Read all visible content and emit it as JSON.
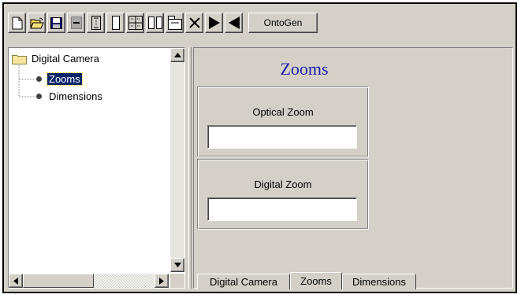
{
  "toolbar": {
    "buttons": [
      {
        "name": "new-document-icon"
      },
      {
        "name": "open-folder-icon"
      },
      {
        "name": "save-disk-icon"
      },
      {
        "name": "horizontal-field-icon"
      },
      {
        "name": "vertical-field-icon"
      },
      {
        "name": "single-panel-icon"
      },
      {
        "name": "grid-layout-icon"
      },
      {
        "name": "two-column-icon"
      },
      {
        "name": "tabbed-panel-icon"
      },
      {
        "name": "delete-icon"
      },
      {
        "name": "play-forward-icon"
      },
      {
        "name": "play-back-icon"
      }
    ],
    "ontogen_label": "OntoGen"
  },
  "tree": {
    "root_label": "Digital Camera",
    "children": [
      {
        "label": "Zooms",
        "selected": true
      },
      {
        "label": "Dimensions",
        "selected": false
      }
    ]
  },
  "form": {
    "title": "Zooms",
    "fields": [
      {
        "label": "Optical Zoom",
        "value": ""
      },
      {
        "label": "Digital Zoom",
        "value": ""
      }
    ]
  },
  "tabs": [
    {
      "label": "Digital Camera",
      "active": false
    },
    {
      "label": "Zooms",
      "active": true
    },
    {
      "label": "Dimensions",
      "active": false
    }
  ],
  "colors": {
    "title": "#1c1ca8",
    "selection": "#0a246a",
    "face": "#d4d0c8"
  }
}
